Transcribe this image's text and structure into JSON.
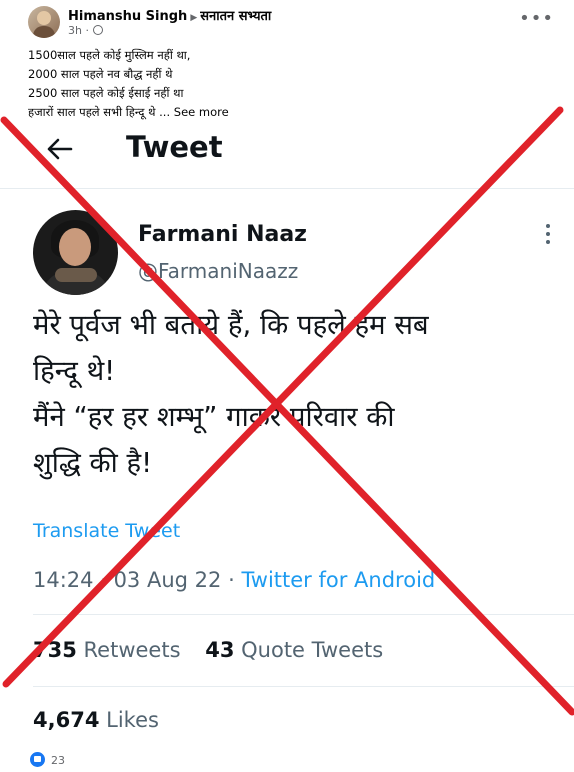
{
  "fb_post": {
    "author": "Himanshu Singh",
    "group": "सनातन सभ्यता",
    "time": "3h",
    "caption_lines": [
      "1500साल पहले कोई मुस्लिम नहीं था,",
      "2000 साल पहले नव बौद्ध नहीं थे",
      "2500 साल पहले कोई ईसाई नहीं था"
    ],
    "caption_last": "हजारों साल पहले सभी हिन्दू थे ...",
    "see_more": "See more",
    "reaction_count": "23"
  },
  "tweet": {
    "page_title": "Tweet",
    "name": "Farmani Naaz",
    "handle": "@FarmaniNaazz",
    "text_lines": [
      "मेरे पूर्वज भी बताये हैं, कि पहले हम सब",
      "हिन्दू थे!",
      "मैंने “हर हर शम्भू” गाकर परिवार की",
      "शुद्धि की है!"
    ],
    "translate": "Translate Tweet",
    "time": "14:24",
    "date": "03 Aug 22",
    "separator": "·",
    "source": "Twitter for Android",
    "retweets": "735",
    "retweets_label": "Retweets",
    "quotes": "43",
    "quotes_label": "Quote Tweets",
    "likes": "4,674",
    "likes_label": "Likes"
  },
  "icons": [
    "back-arrow-icon",
    "more-vertical-icon",
    "more-horizontal-icon",
    "globe-icon",
    "like-icon"
  ],
  "colors": {
    "twitter_blue": "#1d9bf0",
    "fake_cross_red": "#e0222a",
    "fb_like_blue": "#1877f2"
  }
}
